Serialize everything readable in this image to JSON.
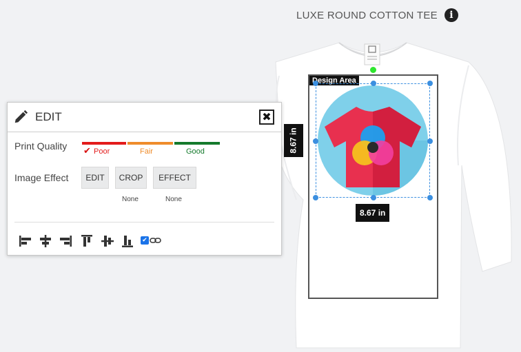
{
  "product": {
    "title": "LUXE ROUND COTTON TEE",
    "info_icon": "i"
  },
  "canvas": {
    "design_area_label": "Design Area",
    "width_label": "8.67 in",
    "height_label": "8.67 in"
  },
  "panel": {
    "title": "EDIT",
    "close_icon": "✖",
    "print_quality": {
      "label": "Print Quality",
      "levels": [
        {
          "label": "Poor",
          "color": "#e31b1b"
        },
        {
          "label": "Fair",
          "color": "#ef8c2b"
        },
        {
          "label": "Good",
          "color": "#147a2c"
        }
      ],
      "selected": "Poor",
      "check_icon": "✔"
    },
    "image_effect": {
      "label": "Image Effect",
      "buttons": [
        {
          "label": "EDIT",
          "sub": ""
        },
        {
          "label": "CROP",
          "sub": "None"
        },
        {
          "label": "EFFECT",
          "sub": "None"
        }
      ]
    },
    "lock_checked": true,
    "lock_check_icon": "✔"
  }
}
